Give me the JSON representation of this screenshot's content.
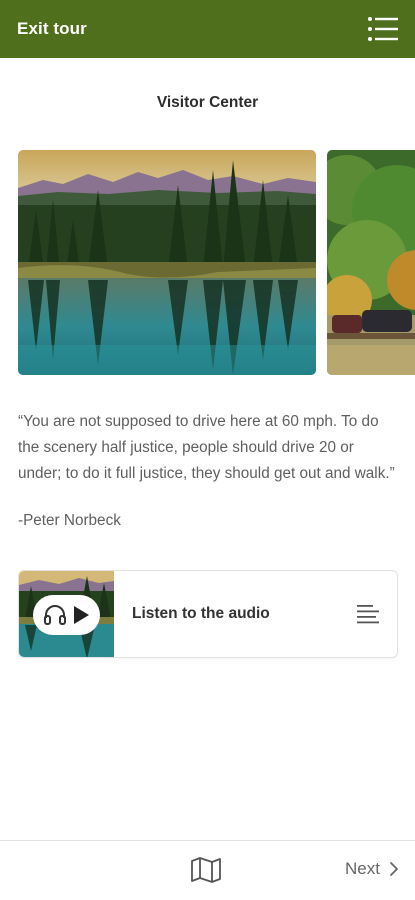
{
  "header": {
    "exit_label": "Exit tour",
    "menu_icon": "list-menu-icon",
    "background": "#4f6f1c"
  },
  "stop": {
    "title": "Visitor Center"
  },
  "gallery": {
    "images": [
      "mountain-lake-photo",
      "parking-lot-trees-photo"
    ]
  },
  "quote": {
    "text": "“You are not supposed to drive here at 60 mph. To do the scenery half justice, people should drive 20 or under; to do it full justice, they should get out and walk.”",
    "author": "-Peter Norbeck"
  },
  "audio": {
    "label": "Listen to the audio",
    "play_icon": "play-icon",
    "headphones_icon": "headphones-icon",
    "transcript_icon": "transcript-lines-icon"
  },
  "footer": {
    "map_icon": "map-icon",
    "next_label": "Next",
    "next_icon": "chevron-right-icon"
  }
}
